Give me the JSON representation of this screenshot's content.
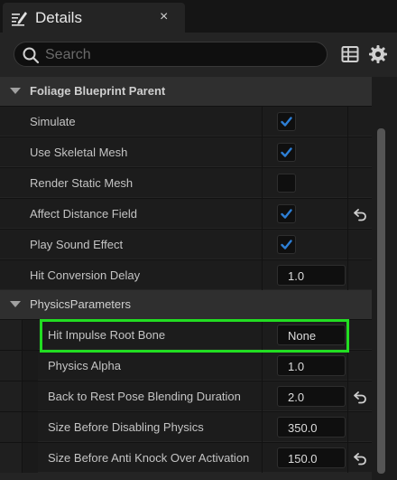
{
  "tab": {
    "title": "Details",
    "close_glyph": "×"
  },
  "search": {
    "placeholder": "Search",
    "value": ""
  },
  "toolbar": {
    "grid_icon": "table-view-icon",
    "settings_icon": "gear-icon"
  },
  "categories": [
    {
      "title": "Foliage Blueprint Parent",
      "rows": [
        {
          "label": "Simulate",
          "type": "checkbox",
          "checked": true,
          "reset": false
        },
        {
          "label": "Use Skeletal Mesh",
          "type": "checkbox",
          "checked": true,
          "reset": false
        },
        {
          "label": "Render Static Mesh",
          "type": "checkbox",
          "checked": false,
          "reset": false
        },
        {
          "label": "Affect Distance Field",
          "type": "checkbox",
          "checked": true,
          "reset": true
        },
        {
          "label": "Play Sound Effect",
          "type": "checkbox",
          "checked": true,
          "reset": false
        },
        {
          "label": "Hit Conversion Delay",
          "type": "number",
          "value": "1.0",
          "reset": false
        }
      ]
    },
    {
      "title": "PhysicsParameters",
      "rows": [
        {
          "label": "Hit Impulse Root Bone",
          "type": "dropdown",
          "value": "None",
          "reset": false
        },
        {
          "label": "Physics Alpha",
          "type": "number",
          "value": "1.0",
          "reset": false
        },
        {
          "label": "Back to Rest Pose Blending Duration",
          "type": "number",
          "value": "2.0",
          "reset": true
        },
        {
          "label": "Size Before Disabling Physics",
          "type": "number",
          "value": "350.0",
          "reset": false
        },
        {
          "label": "Size Before Anti Knock Over Activation",
          "type": "number",
          "value": "150.0",
          "reset": true
        }
      ]
    }
  ],
  "colors": {
    "accent": "#2d7fd6",
    "highlight": "#22dd22"
  }
}
